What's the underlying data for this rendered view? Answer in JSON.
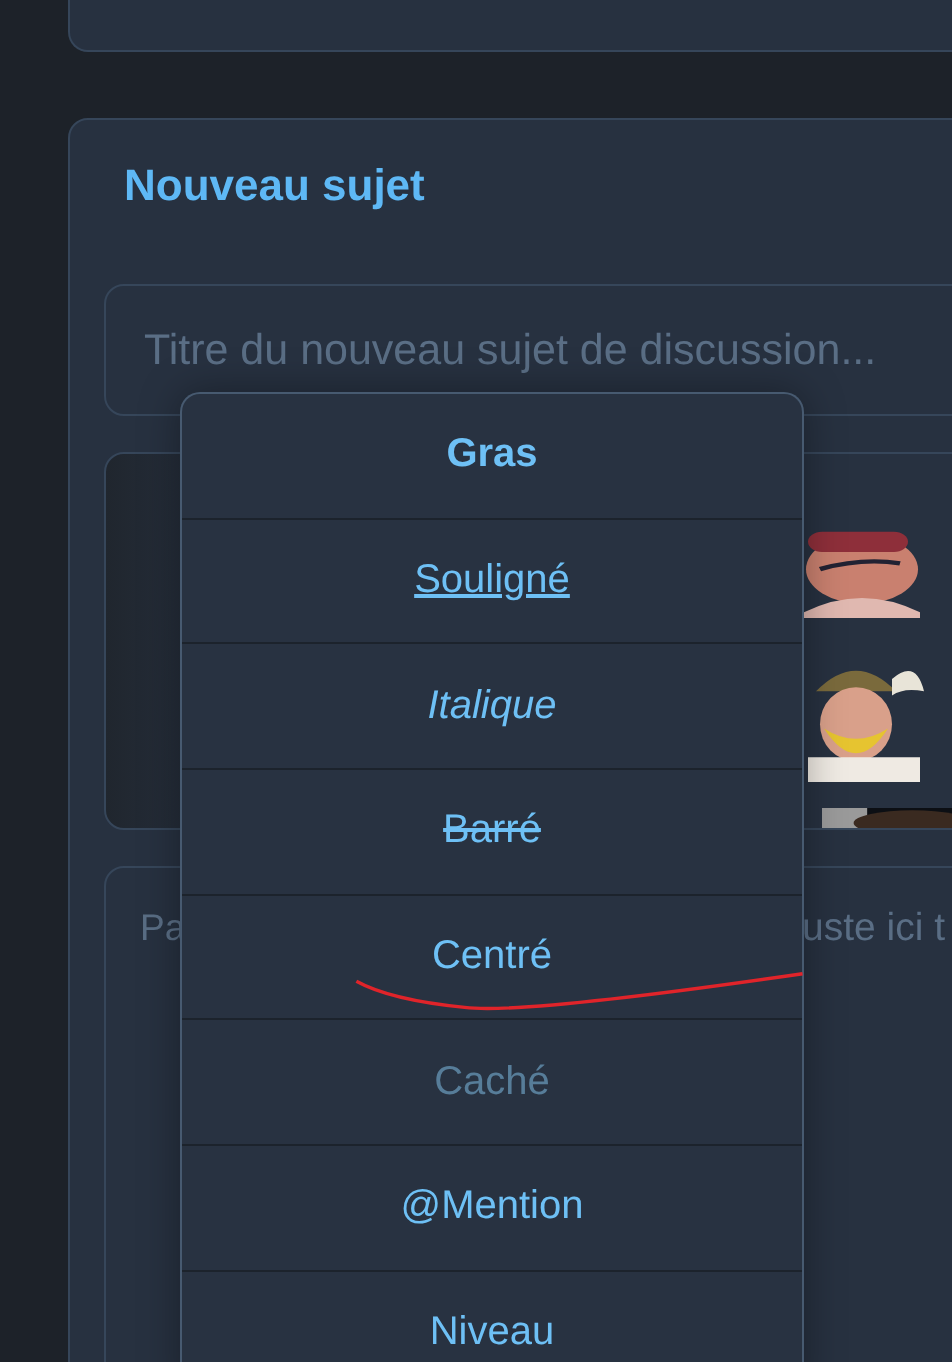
{
  "new_topic": {
    "title": "Nouveau sujet",
    "title_field": {
      "placeholder": "Titre du nouveau sujet de discussion..."
    },
    "message_field": {
      "placeholder_parts": [
        "Pa",
        "uste ici t"
      ]
    }
  },
  "format_menu": {
    "items": [
      {
        "label": "Gras",
        "kind": "bold"
      },
      {
        "label": "Souligné",
        "kind": "underline"
      },
      {
        "label": "Italique",
        "kind": "italic"
      },
      {
        "label": "Barré",
        "kind": "strike"
      },
      {
        "label": "Centré",
        "kind": "center"
      },
      {
        "label": "Caché",
        "kind": "hidden"
      },
      {
        "label": "@Mention",
        "kind": "mention"
      },
      {
        "label": "Niveau",
        "kind": "level"
      }
    ]
  }
}
